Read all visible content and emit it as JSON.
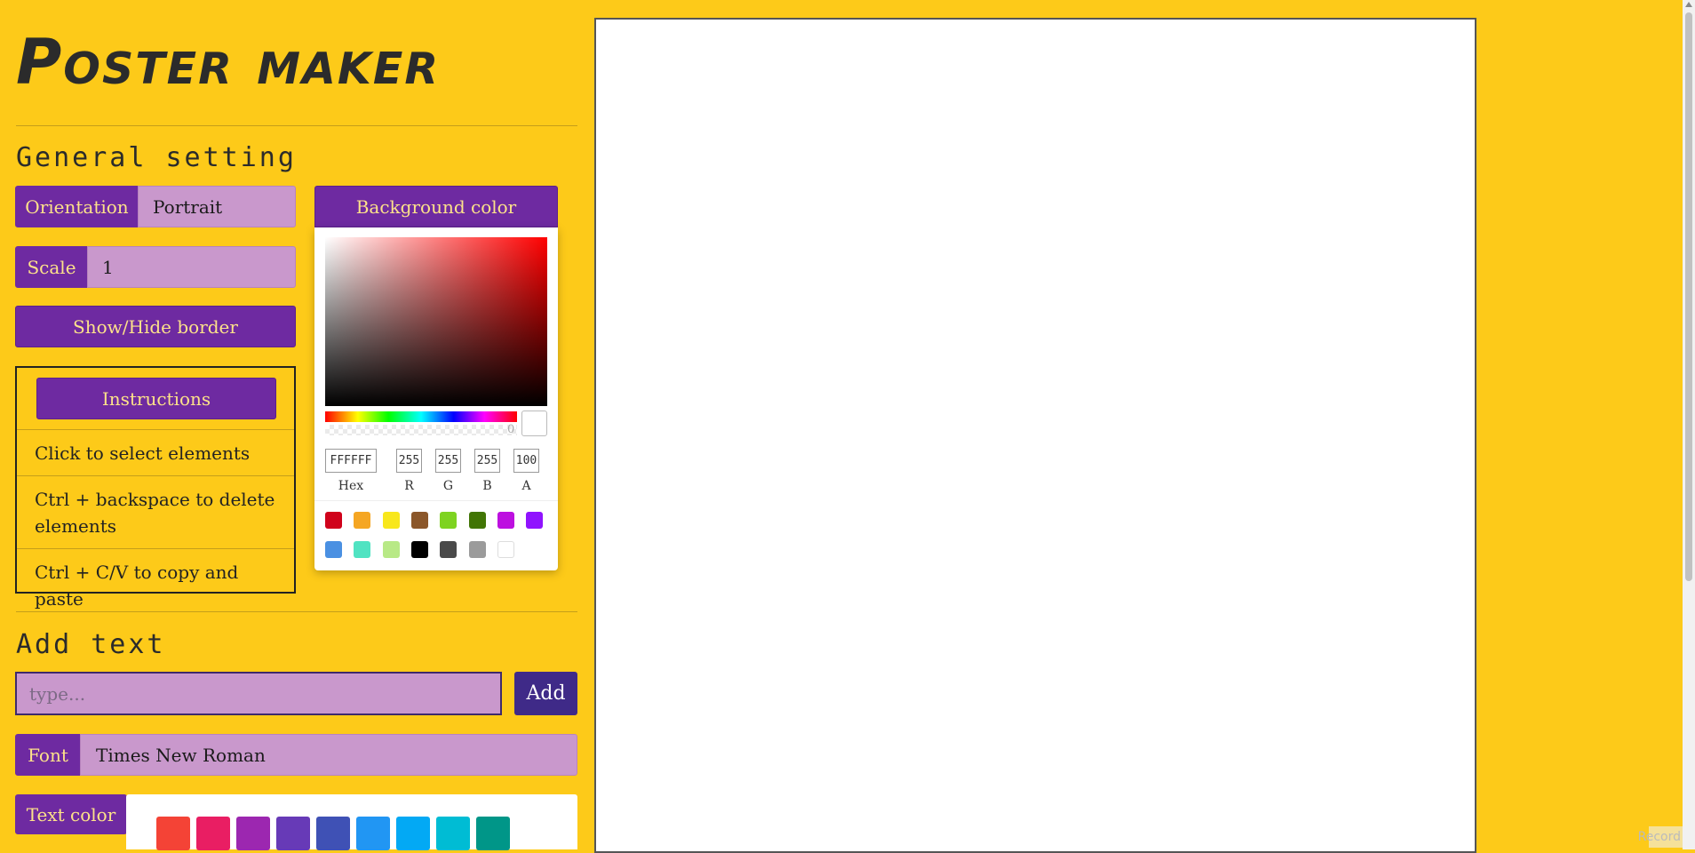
{
  "app": {
    "title": "Poster maker"
  },
  "general": {
    "heading": "General setting",
    "orientation_label": "Orientation",
    "orientation_value": "Portrait",
    "scale_label": "Scale",
    "scale_value": "1",
    "border_button": "Show/Hide border",
    "bg_color_button": "Background color"
  },
  "instructions": {
    "title": "Instructions",
    "items": [
      "Click to select elements",
      "Ctrl + backspace to delete elements",
      "Ctrl + C/V to copy and paste"
    ]
  },
  "color_picker": {
    "hex": "FFFFFF",
    "r": "255",
    "g": "255",
    "b": "255",
    "a": "100",
    "alpha_value": "0",
    "labels": {
      "hex": "Hex",
      "r": "R",
      "g": "G",
      "b": "B",
      "a": "A"
    },
    "swatches": [
      "#D0021B",
      "#F5A623",
      "#F8E71C",
      "#8B572A",
      "#7ED321",
      "#417505",
      "#BD10E0",
      "#9013FE",
      "#4A90E2",
      "#50E3C2",
      "#B8E986",
      "#000000",
      "#4A4A4A",
      "#9B9B9B",
      "#FFFFFF"
    ]
  },
  "add_text": {
    "heading": "Add text",
    "placeholder": "type...",
    "add_button": "Add",
    "font_label": "Font",
    "font_value": "Times New Roman",
    "text_color_label": "Text color",
    "text_swatches": [
      "#f44336",
      "#e91e63",
      "#9c27b0",
      "#673ab7",
      "#3f51b5",
      "#2196f3",
      "#03a9f4",
      "#00bcd4",
      "#009688"
    ]
  },
  "footer": {
    "record": "Record"
  },
  "colors": {
    "page_bg": "#fdca19",
    "accent": "#6e2aa1",
    "field": "#c998cc"
  }
}
